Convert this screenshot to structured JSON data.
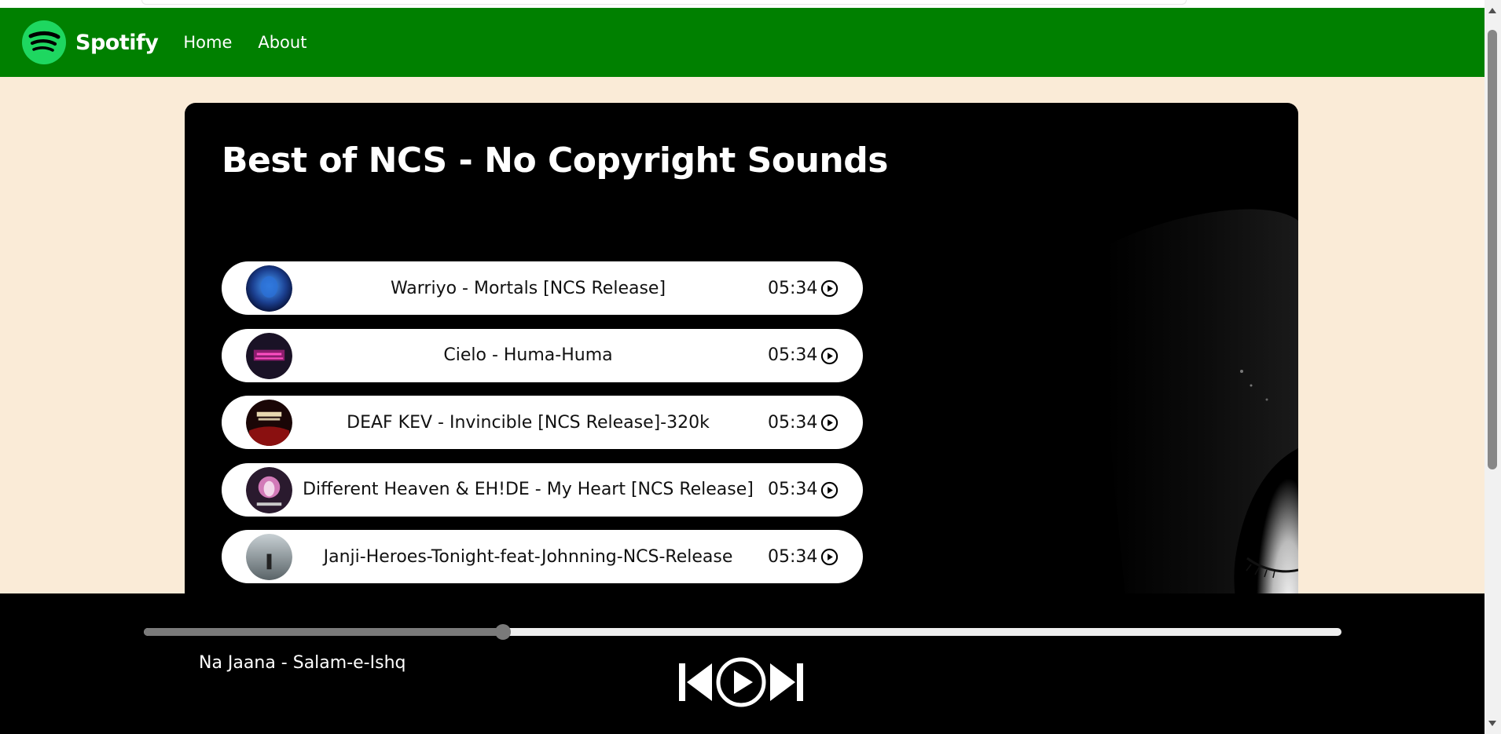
{
  "nav": {
    "brand": "Spotify",
    "links": [
      "Home",
      "About"
    ]
  },
  "playlist": {
    "title": "Best of NCS - No Copyright Sounds",
    "songs": [
      {
        "name": "Warriyo - Mortals [NCS Release]",
        "duration": "05:34"
      },
      {
        "name": "Cielo - Huma-Huma",
        "duration": "05:34"
      },
      {
        "name": "DEAF KEV - Invincible [NCS Release]-320k",
        "duration": "05:34"
      },
      {
        "name": "Different Heaven & EH!DE - My Heart [NCS Release]",
        "duration": "05:34"
      },
      {
        "name": "Janji-Heroes-Tonight-feat-Johnning-NCS-Release",
        "duration": "05:34"
      }
    ]
  },
  "player": {
    "now_playing": "Na Jaana - Salam-e-Ishq",
    "progress_percent": 30
  },
  "colors": {
    "nav_bg": "#008000",
    "page_bg": "#faebd7",
    "logo_green": "#1ed760"
  }
}
